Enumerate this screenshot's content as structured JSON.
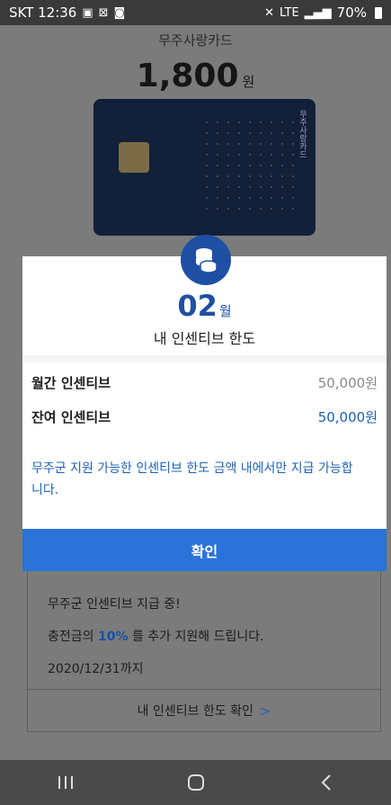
{
  "status_bar": {
    "carrier_time": "SKT 12:36",
    "left_icons": [
      "image-icon",
      "no-network-icon",
      "notification-icon"
    ],
    "signal_text": "LTE",
    "battery": "70%"
  },
  "background": {
    "card_name": "무주사랑카드",
    "balance_amount": "1,800",
    "balance_unit": "원",
    "card_side_text": "무주사랑카드",
    "promo": {
      "line1": "무주군 인센티브 지급 중!",
      "line2_prefix": "충전금의 ",
      "line2_highlight": "10%",
      "line2_suffix": " 를 추가 지원해 드립니다.",
      "line3": "2020/12/31까지",
      "check_link": "내 인센티브 한도 확인"
    }
  },
  "modal": {
    "icon": "coins-icon",
    "month_num": "02",
    "month_unit": "월",
    "title": "내 인센티브 한도",
    "rows": [
      {
        "label": "월간 인센티브",
        "value": "50,000원"
      },
      {
        "label": "잔여 인센티브",
        "value": "50,000원"
      }
    ],
    "note": "무주군 지원 가능한 인센티브 한도 금액 내에서만 지급 가능합니다.",
    "confirm": "확인"
  },
  "colors": {
    "accent": "#2b73d9",
    "accent_dark": "#1f4fa3",
    "note_blue": "#1f63b5"
  }
}
